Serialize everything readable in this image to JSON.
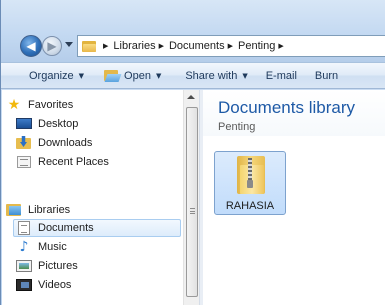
{
  "address": {
    "crumbs": [
      "Libraries",
      "Documents",
      "Penting"
    ]
  },
  "toolbar": {
    "organize_label": "Organize",
    "open_label": "Open",
    "share_label": "Share with",
    "email_label": "E-mail",
    "burn_label": "Burn"
  },
  "sidebar": {
    "favorites_label": "Favorites",
    "favorites": [
      {
        "label": "Desktop",
        "icon": "desktop-icon"
      },
      {
        "label": "Downloads",
        "icon": "downloads-icon"
      },
      {
        "label": "Recent Places",
        "icon": "recent-places-icon"
      }
    ],
    "libraries_label": "Libraries",
    "libraries": [
      {
        "label": "Documents",
        "icon": "documents-icon",
        "selected": true
      },
      {
        "label": "Music",
        "icon": "music-icon"
      },
      {
        "label": "Pictures",
        "icon": "pictures-icon"
      },
      {
        "label": "Videos",
        "icon": "videos-icon"
      }
    ]
  },
  "main": {
    "title": "Documents library",
    "subtitle": "Penting",
    "items": [
      {
        "name": "RAHASIA",
        "icon": "zip-folder-icon",
        "selected": true
      }
    ]
  },
  "colors": {
    "title_blue": "#1e5aa6",
    "selection_fill": "#ddecfb",
    "selection_border": "#a9cdf0"
  }
}
